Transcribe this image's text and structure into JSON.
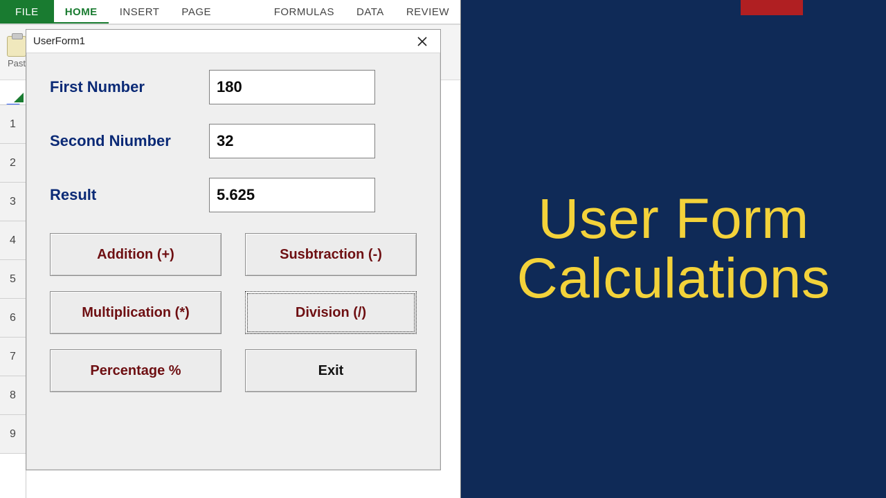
{
  "ribbon": {
    "file": "FILE",
    "tabs": [
      "HOME",
      "INSERT",
      "PAGE LAYOUT",
      "FORMULAS",
      "DATA",
      "REVIEW"
    ],
    "active_index": 0,
    "paste_label": "Past"
  },
  "grid": {
    "row_headers": [
      "1",
      "2",
      "3",
      "4",
      "5",
      "6",
      "7",
      "8",
      "9"
    ]
  },
  "userform": {
    "title": "UserForm1",
    "labels": {
      "first": "First Number",
      "second": "Second Niumber",
      "result": "Result"
    },
    "values": {
      "first": "180",
      "second": "32",
      "result": "5.625"
    },
    "buttons": {
      "add": "Addition (+)",
      "sub": "Susbtraction (-)",
      "mul": "Multiplication (*)",
      "div": "Division (/)",
      "pct": "Percentage %",
      "exit": "Exit"
    }
  },
  "caption": {
    "line1": "User Form",
    "line2": "Calculations"
  },
  "colors": {
    "excel_green": "#197b30",
    "navy": "#0f2a57",
    "yellow_text": "#f3d23a",
    "label_blue": "#0b2a76",
    "button_red": "#6e0f12"
  }
}
